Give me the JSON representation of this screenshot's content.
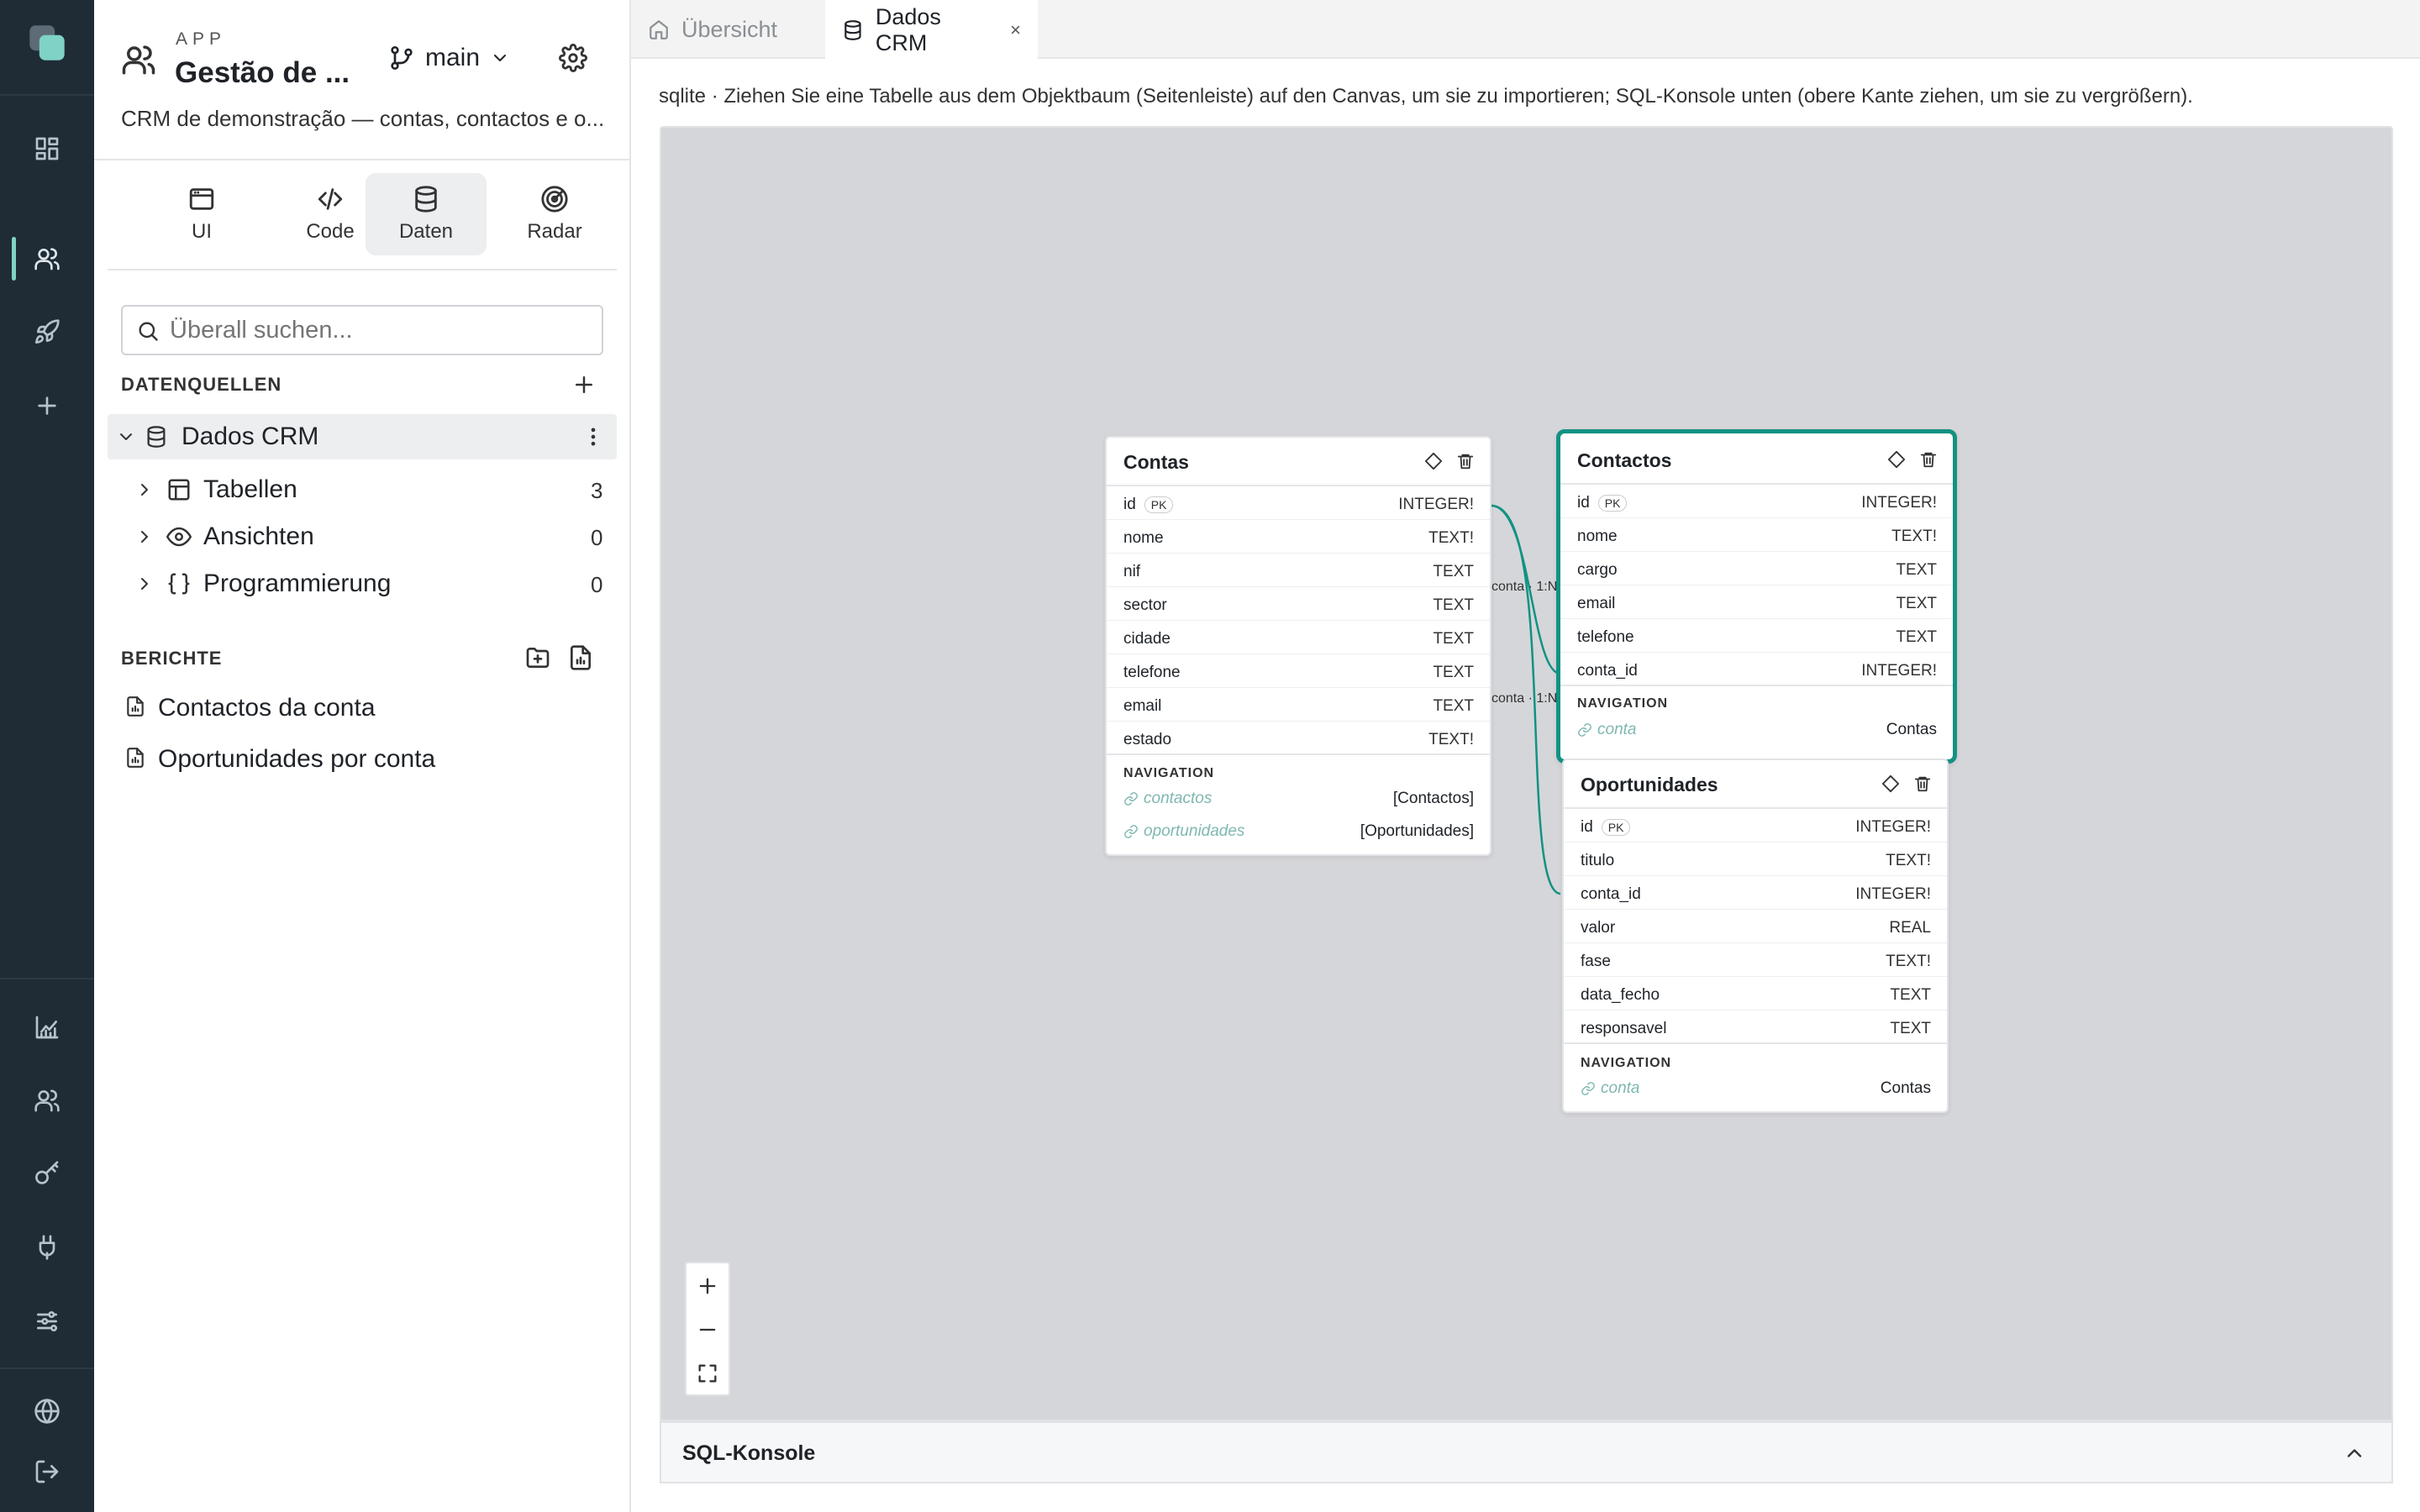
{
  "rail": {
    "icons": [
      "logo-icon",
      "dashboard-icon",
      "users-icon",
      "rocket-icon",
      "plus-icon",
      "analytics-icon",
      "team-icon",
      "key-icon",
      "plug-icon",
      "sliders-icon",
      "globe-icon",
      "logout-icon"
    ]
  },
  "sidebar": {
    "app_label": "APP",
    "app_name": "Gestão de ...",
    "branch": "main",
    "description": "CRM de demonstração — contas, contactos e o...",
    "tabs": [
      {
        "label": "UI",
        "icon": "window-icon"
      },
      {
        "label": "Code",
        "icon": "code-icon"
      },
      {
        "label": "Daten",
        "icon": "database-icon"
      },
      {
        "label": "Radar",
        "icon": "radar-icon"
      }
    ],
    "active_tab": "Daten",
    "search_placeholder": "Überall suchen...",
    "datasources_heading": "DATENQUELLEN",
    "datasource": "Dados CRM",
    "tree": [
      {
        "label": "Tabellen",
        "count": "3"
      },
      {
        "label": "Ansichten",
        "count": "0"
      },
      {
        "label": "Programmierung",
        "count": "0"
      }
    ],
    "reports_heading": "BERICHTE",
    "reports": [
      "Contactos da conta",
      "Oportunidades por conta"
    ]
  },
  "tabs": [
    {
      "label": "Übersicht",
      "active": false
    },
    {
      "label": "Dados CRM",
      "active": true,
      "close": "×"
    }
  ],
  "hint": "sqlite · Ziehen Sie eine Tabelle aus dem Objektbaum (Seitenleiste) auf den Canvas, um sie zu importieren; SQL-Konsole unten (obere Kante ziehen, um sie zu vergrößern).",
  "canvas": {
    "tables": [
      {
        "name": "Contas",
        "selected": false,
        "fields": [
          {
            "name": "id",
            "pk": "PK",
            "type": "INTEGER!"
          },
          {
            "name": "nome",
            "type": "TEXT!"
          },
          {
            "name": "nif",
            "type": "TEXT"
          },
          {
            "name": "sector",
            "type": "TEXT"
          },
          {
            "name": "cidade",
            "type": "TEXT"
          },
          {
            "name": "telefone",
            "type": "TEXT"
          },
          {
            "name": "email",
            "type": "TEXT"
          },
          {
            "name": "estado",
            "type": "TEXT!"
          }
        ],
        "nav_heading": "NAVIGATION",
        "navigation": [
          {
            "name": "contactos",
            "target": "[Contactos]"
          },
          {
            "name": "oportunidades",
            "target": "[Oportunidades]"
          }
        ]
      },
      {
        "name": "Contactos",
        "selected": true,
        "fields": [
          {
            "name": "id",
            "pk": "PK",
            "type": "INTEGER!"
          },
          {
            "name": "nome",
            "type": "TEXT!"
          },
          {
            "name": "cargo",
            "type": "TEXT"
          },
          {
            "name": "email",
            "type": "TEXT"
          },
          {
            "name": "telefone",
            "type": "TEXT"
          },
          {
            "name": "conta_id",
            "type": "INTEGER!"
          }
        ],
        "nav_heading": "NAVIGATION",
        "navigation": [
          {
            "name": "conta",
            "target": "Contas"
          }
        ]
      },
      {
        "name": "Oportunidades",
        "selected": false,
        "fields": [
          {
            "name": "id",
            "pk": "PK",
            "type": "INTEGER!"
          },
          {
            "name": "titulo",
            "type": "TEXT!"
          },
          {
            "name": "conta_id",
            "type": "INTEGER!"
          },
          {
            "name": "valor",
            "type": "REAL"
          },
          {
            "name": "fase",
            "type": "TEXT!"
          },
          {
            "name": "data_fecho",
            "type": "TEXT"
          },
          {
            "name": "responsavel",
            "type": "TEXT"
          }
        ],
        "nav_heading": "NAVIGATION",
        "navigation": [
          {
            "name": "conta",
            "target": "Contas"
          }
        ]
      }
    ],
    "edges": [
      {
        "label": "conta · 1:N"
      },
      {
        "label": "conta · 1:N"
      }
    ]
  },
  "sql_console": {
    "label": "SQL-Konsole"
  },
  "colors": {
    "rail": "#1f2c36",
    "accent": "#129283",
    "canvas": "#d5d6d9"
  }
}
